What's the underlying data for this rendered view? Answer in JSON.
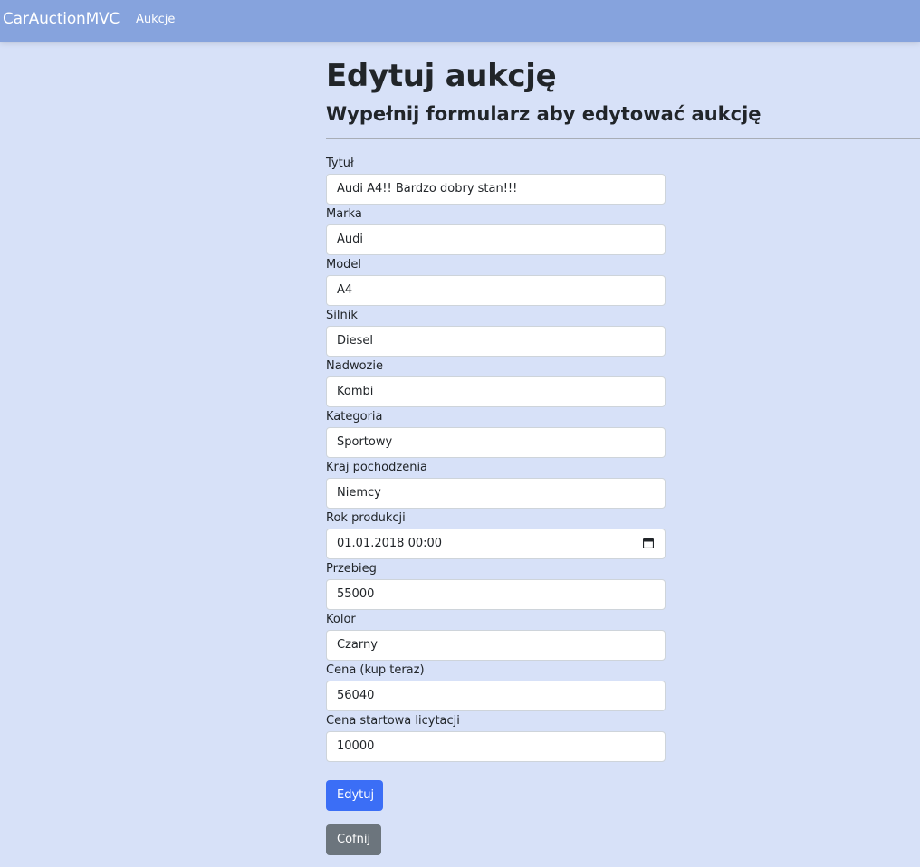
{
  "navbar": {
    "brand": "CarAuctionMVC",
    "links": [
      "Aukcje"
    ]
  },
  "page": {
    "title": "Edytuj aukcję",
    "subtitle": "Wypełnij formularz aby edytować aukcję"
  },
  "form": {
    "fields": [
      {
        "label": "Tytuł",
        "value": "Audi A4!! Bardzo dobry stan!!!"
      },
      {
        "label": "Marka",
        "value": "Audi"
      },
      {
        "label": "Model",
        "value": "A4"
      },
      {
        "label": "Silnik",
        "value": "Diesel"
      },
      {
        "label": "Nadwozie",
        "value": "Kombi"
      },
      {
        "label": "Kategoria",
        "value": "Sportowy"
      },
      {
        "label": "Kraj pochodzenia",
        "value": "Niemcy"
      },
      {
        "label": "Rok produkcji",
        "value": "01.01.2018 00:00",
        "icon": "calendar-icon"
      },
      {
        "label": "Przebieg",
        "value": "55000"
      },
      {
        "label": "Kolor",
        "value": "Czarny"
      },
      {
        "label": "Cena (kup teraz)",
        "value": "56040"
      },
      {
        "label": "Cena startowa licytacji",
        "value": "10000"
      }
    ],
    "submit_label": "Edytuj",
    "back_label": "Cofnij"
  },
  "colors": {
    "navbar": "#86a3dd",
    "background": "#d7e1f8",
    "primary_button": "#3b6ef6",
    "secondary_button": "#6c757d"
  }
}
